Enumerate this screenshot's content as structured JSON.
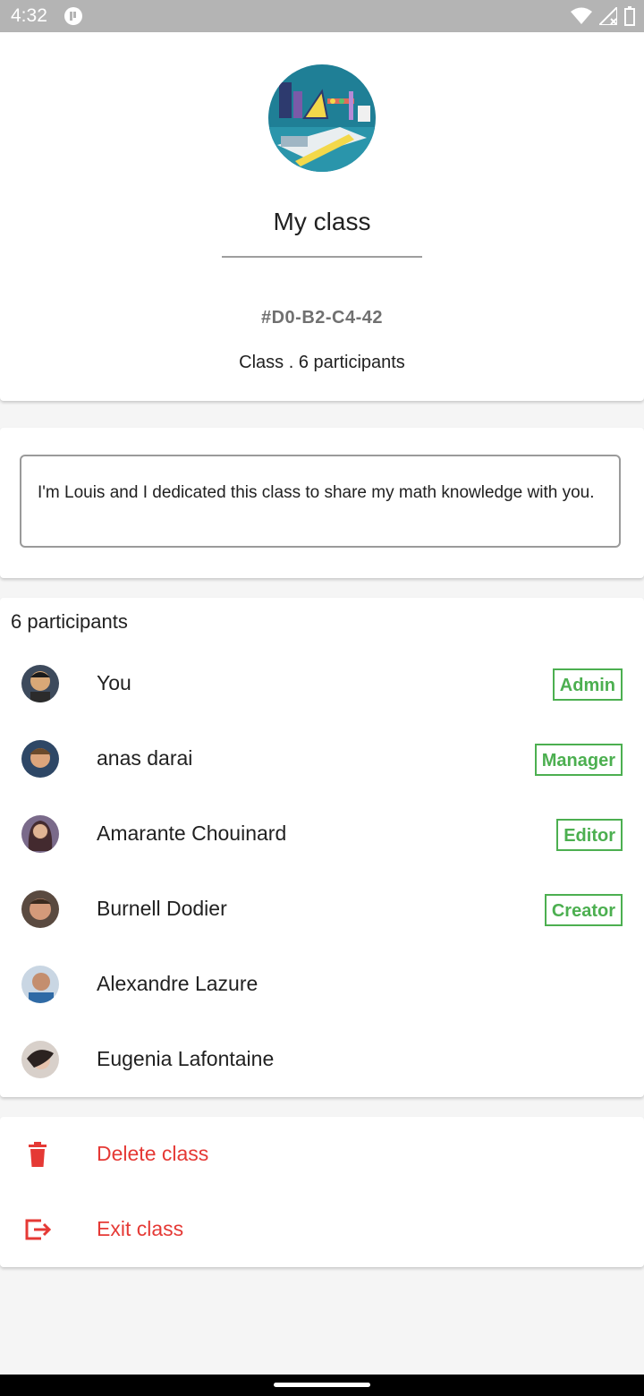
{
  "status_bar": {
    "time": "4:32",
    "icons": [
      "app-notification-icon",
      "wifi-icon",
      "signal-icon",
      "battery-icon"
    ]
  },
  "class_info": {
    "name": "My class",
    "code": "#D0-B2-C4-42",
    "meta": "Class . 6 participants"
  },
  "description": {
    "text": "I'm Louis and I dedicated this class to share my math knowledge with you."
  },
  "participants": {
    "title": "6 participants",
    "items": [
      {
        "name": "You",
        "role": "Admin"
      },
      {
        "name": "anas darai",
        "role": "Manager"
      },
      {
        "name": "Amarante Chouinard",
        "role": "Editor"
      },
      {
        "name": "Burnell Dodier",
        "role": "Creator"
      },
      {
        "name": "Alexandre Lazure",
        "role": ""
      },
      {
        "name": "Eugenia Lafontaine",
        "role": ""
      }
    ]
  },
  "actions": {
    "delete_label": "Delete class",
    "exit_label": "Exit class"
  },
  "colors": {
    "accent_green": "#4caf50",
    "danger_red": "#e53935"
  }
}
